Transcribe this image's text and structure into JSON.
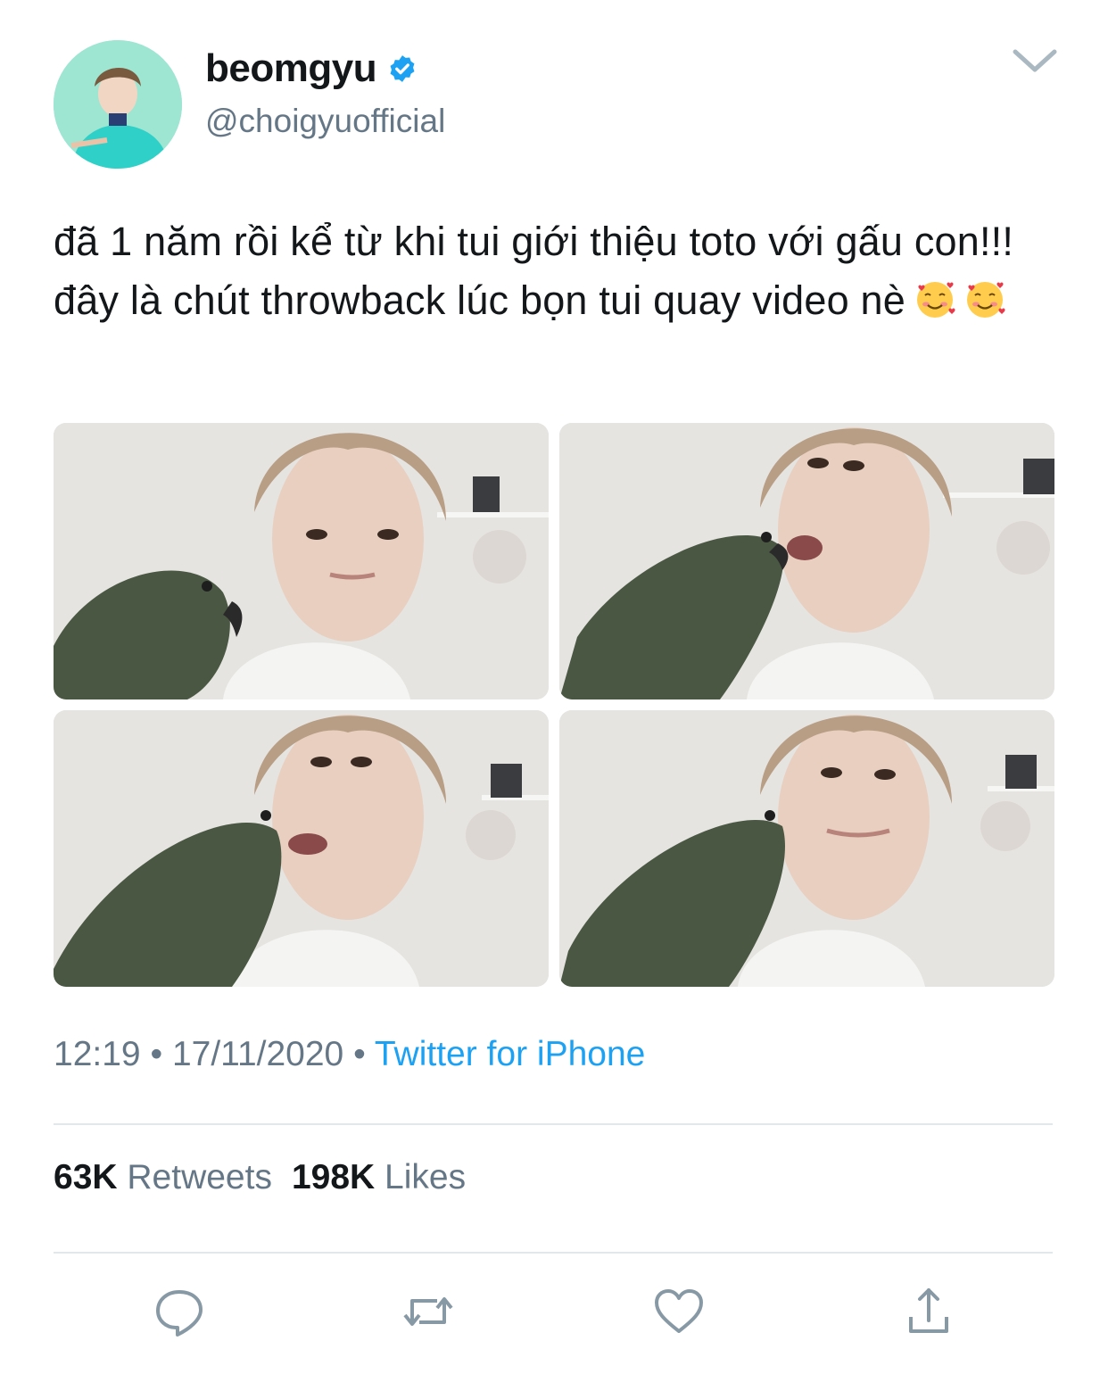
{
  "author": {
    "display_name": "beomgyu",
    "handle": "@choigyuofficial",
    "verified_icon": "verified-badge-icon",
    "avatar": "profile-avatar"
  },
  "tweet": {
    "text": "đã 1 năm rồi kể từ khi tui giới thiệu toto với gấu con!!! đây là chút throwback lúc bọn tui quay video nè",
    "emojis": [
      "smiling-face-with-hearts",
      "smiling-face-with-hearts"
    ],
    "photos": [
      "photo-1",
      "photo-2",
      "photo-3",
      "photo-4"
    ],
    "time": "12:19",
    "date": "17/11/2020",
    "separator": "•",
    "source": "Twitter for iPhone"
  },
  "stats": {
    "retweets_count": "63K",
    "retweets_label": "Retweets",
    "likes_count": "198K",
    "likes_label": "Likes"
  },
  "actions": [
    "reply-icon",
    "retweet-icon",
    "like-icon",
    "share-icon"
  ],
  "colors": {
    "link": "#1da1f2",
    "secondary_text": "#657786",
    "primary_text": "#14171a",
    "divider": "#e1e8ed",
    "icon": "#8899a6"
  }
}
